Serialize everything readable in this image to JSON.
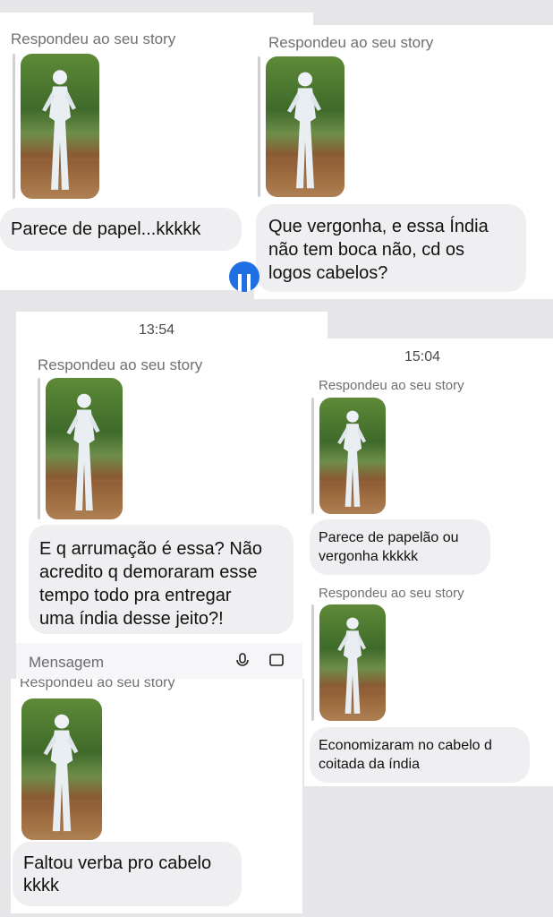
{
  "screens": [
    {
      "label": "Respondeu ao seu story",
      "message": "Parece de papel...kkkkk"
    },
    {
      "label": "Respondeu ao seu story",
      "message": "Que vergonha,  e essa Índia\nnão  tem boca não,  cd os\nlogos cabelos?"
    },
    {
      "time": "13:54",
      "label": "Respondeu ao seu story",
      "message": "E q arrumação é essa? Não\nacredito q demoraram esse\ntempo todo pra entregar\numa índia desse jeito?!",
      "composer_placeholder": "Mensagem"
    },
    {
      "time": "15:04",
      "label": "Respondeu ao seu story",
      "message": "Parece de papelão ou\nvergonha kkkkk",
      "label_2": "Respondeu ao seu story",
      "message_2": "Economizaram no cabelo d\ncoitada da índia"
    },
    {
      "label": "Respondeu ao seu story",
      "message": "Faltou verba pro cabelo\nkkkk"
    }
  ],
  "colors": {
    "bubble": "#efeff2",
    "label": "#707074",
    "avatar": "#1f6fe5",
    "page": "#e6e6e9"
  },
  "icons": [
    "story-thumbnail-icon",
    "microphone-icon",
    "gallery-icon",
    "avatar"
  ]
}
